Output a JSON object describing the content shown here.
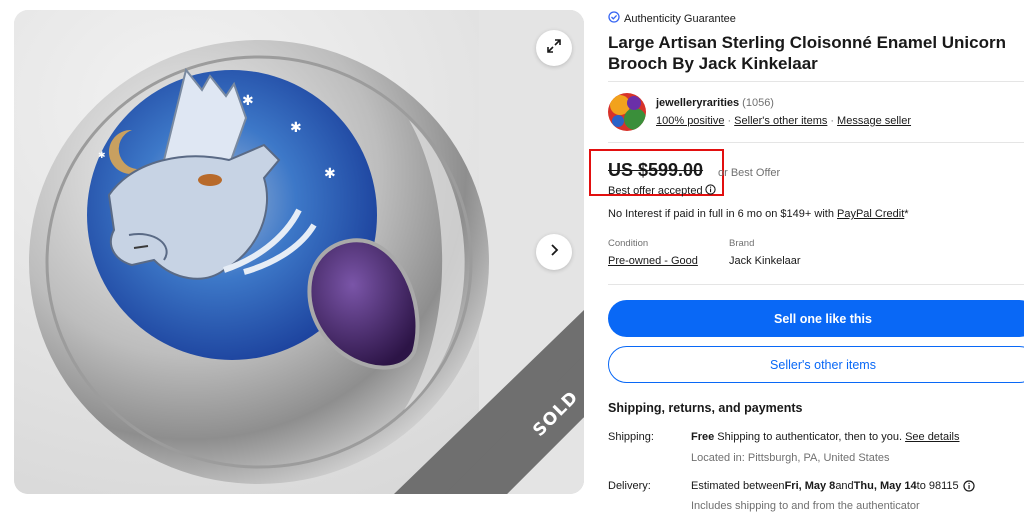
{
  "gallery": {
    "sold_label": "SOLD",
    "expand_icon": "expand-icon",
    "next_icon": "chevron-right-icon"
  },
  "authenticity": {
    "icon": "check-badge-icon",
    "label": "Authenticity Guarantee",
    "color": "#3665f3"
  },
  "listing": {
    "title": "Large Artisan Sterling Cloisonné Enamel Unicorn Brooch By Jack Kinkelaar"
  },
  "seller": {
    "name": "jewelleryrarities",
    "feedback_count": "(1056)",
    "positive": "100% positive",
    "other_items_link": "Seller's other items",
    "message_link": "Message seller"
  },
  "price": {
    "amount": "US $599.00",
    "best_offer": "or Best Offer",
    "offer_status": "Best offer accepted",
    "highlight_color": "#e20f0f"
  },
  "financing": {
    "text": "No Interest if paid in full in 6 mo on $149+ with ",
    "link": "PayPal Credit",
    "suffix": "*"
  },
  "specs": {
    "condition_label": "Condition",
    "condition_value": "Pre-owned - Good",
    "brand_label": "Brand",
    "brand_value": "Jack Kinkelaar"
  },
  "actions": {
    "primary": "Sell one like this",
    "secondary": "Seller's other items",
    "accent": "#0968f6"
  },
  "shipping": {
    "heading": "Shipping, returns, and payments",
    "shipping_label": "Shipping:",
    "shipping_free": "Free",
    "shipping_text": " Shipping to authenticator, then to you. ",
    "shipping_link": "See details",
    "location": "Located in: Pittsburgh, PA, United States",
    "delivery_label": "Delivery:",
    "delivery_prefix": "Estimated between ",
    "delivery_start": "Fri, May 8",
    "delivery_and": " and ",
    "delivery_end": "Thu, May 14",
    "delivery_to": " to 98115",
    "delivery_note": "Includes shipping to and from the authenticator"
  }
}
